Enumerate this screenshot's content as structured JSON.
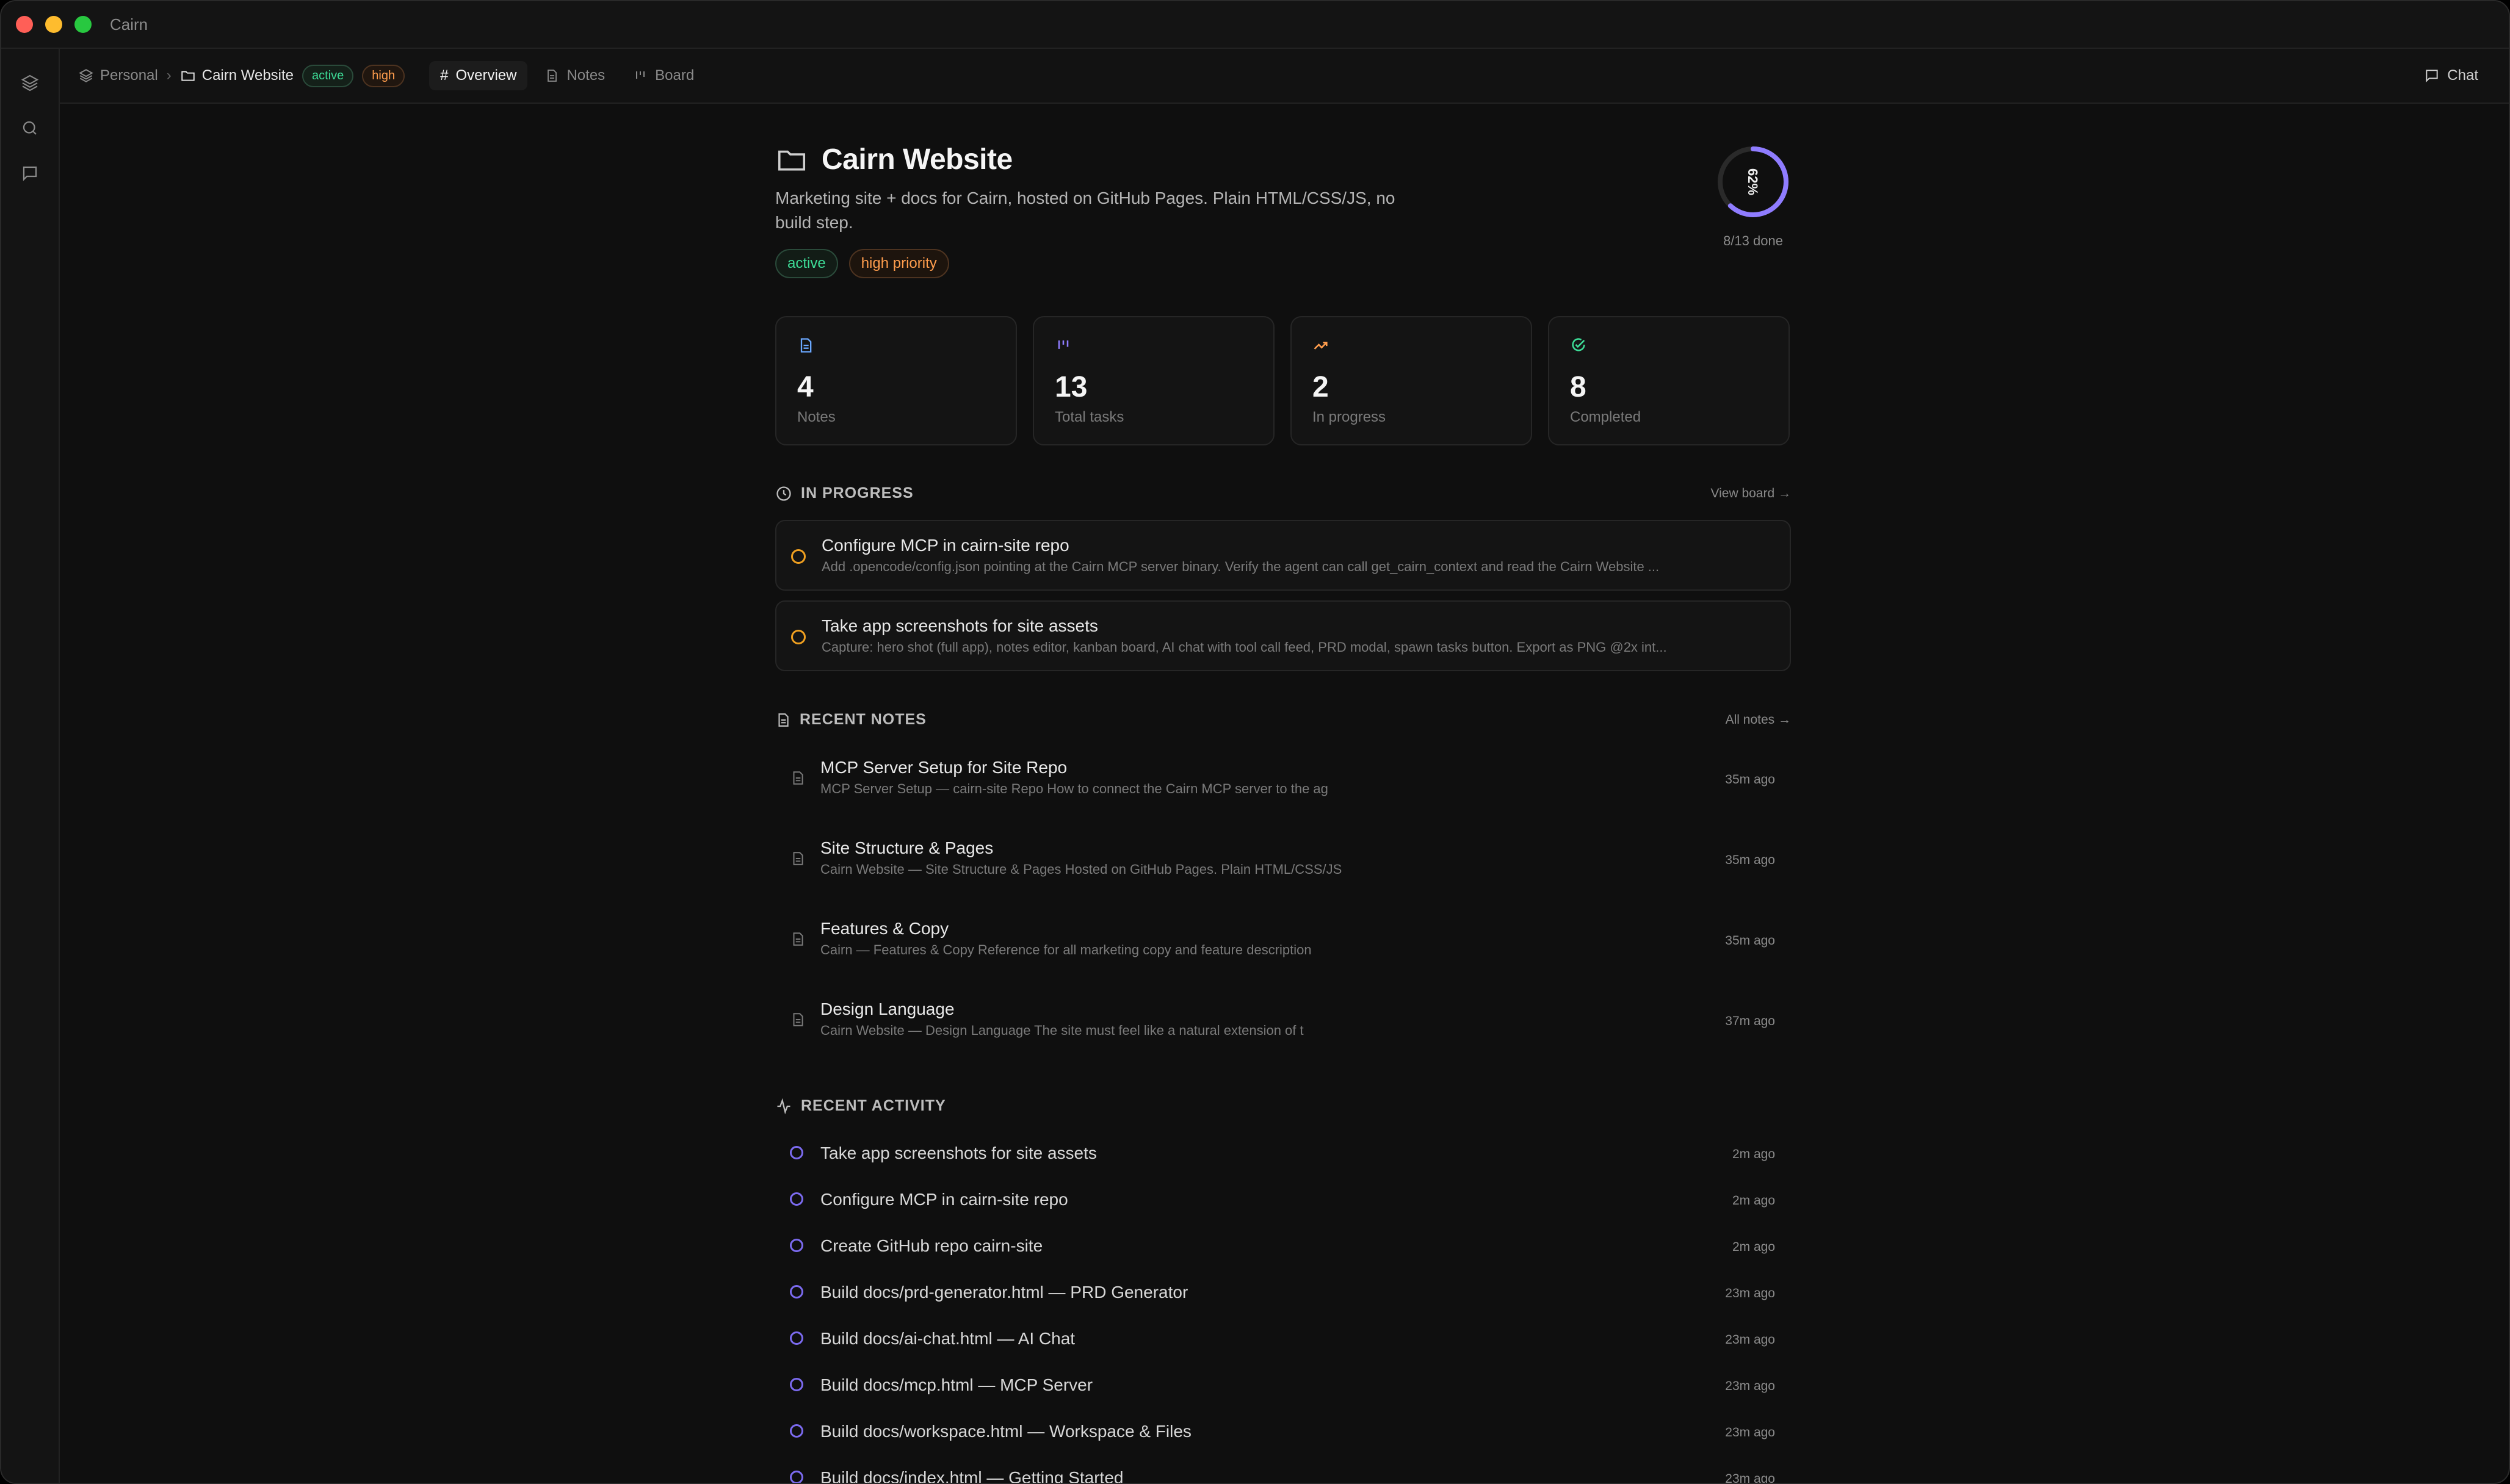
{
  "app": {
    "title": "Cairn"
  },
  "breadcrumb": {
    "workspace": "Personal",
    "project": "Cairn Website",
    "status_badge": "active",
    "priority_badge": "high"
  },
  "tabs": [
    {
      "label": "Overview"
    },
    {
      "label": "Notes"
    },
    {
      "label": "Board"
    }
  ],
  "chat": {
    "label": "Chat"
  },
  "project": {
    "title": "Cairn Website",
    "description": "Marketing site + docs for Cairn, hosted on GitHub Pages. Plain HTML/CSS/JS, no build step.",
    "tags": [
      {
        "label": "active",
        "color": "#3ddc97"
      },
      {
        "label": "high priority",
        "color": "#ff9d4d"
      }
    ],
    "progress": {
      "percent_label": "62%",
      "fraction": 0.62,
      "done_label": "8/13 done"
    }
  },
  "stats": [
    {
      "value": "4",
      "label": "Notes",
      "icon": "document-icon",
      "color": "#6aa8ff"
    },
    {
      "value": "13",
      "label": "Total tasks",
      "icon": "kanban-icon",
      "color": "#8f7cff"
    },
    {
      "value": "2",
      "label": "In progress",
      "icon": "trending-up-icon",
      "color": "#ff9d4d"
    },
    {
      "value": "8",
      "label": "Completed",
      "icon": "check-circle-icon",
      "color": "#3ddc97"
    }
  ],
  "in_progress": {
    "heading": "IN PROGRESS",
    "link": "View board →",
    "items": [
      {
        "title": "Configure MCP in cairn-site repo",
        "subtitle": "Add .opencode/config.json pointing at the Cairn MCP server binary. Verify the agent can call get_cairn_context and read the Cairn Website ..."
      },
      {
        "title": "Take app screenshots for site assets",
        "subtitle": "Capture: hero shot (full app), notes editor, kanban board, AI chat with tool call feed, PRD modal, spawn tasks button. Export as PNG @2x int..."
      }
    ]
  },
  "recent_notes": {
    "heading": "RECENT NOTES",
    "link": "All notes →",
    "items": [
      {
        "title": "MCP Server Setup for Site Repo",
        "subtitle": "MCP Server Setup — cairn-site Repo How to connect the Cairn MCP server to the ag",
        "time": "35m ago"
      },
      {
        "title": "Site Structure & Pages",
        "subtitle": "Cairn Website — Site Structure & Pages Hosted on GitHub Pages. Plain HTML/CSS/JS",
        "time": "35m ago"
      },
      {
        "title": "Features & Copy",
        "subtitle": "Cairn — Features & Copy Reference for all marketing copy and feature description",
        "time": "35m ago"
      },
      {
        "title": "Design Language",
        "subtitle": "Cairn Website — Design Language The site must feel like a natural extension of t",
        "time": "37m ago"
      }
    ]
  },
  "recent_activity": {
    "heading": "RECENT ACTIVITY",
    "items": [
      {
        "title": "Take app screenshots for site assets",
        "time": "2m ago"
      },
      {
        "title": "Configure MCP in cairn-site repo",
        "time": "2m ago"
      },
      {
        "title": "Create GitHub repo cairn-site",
        "time": "2m ago"
      },
      {
        "title": "Build docs/prd-generator.html — PRD Generator",
        "time": "23m ago"
      },
      {
        "title": "Build docs/ai-chat.html — AI Chat",
        "time": "23m ago"
      },
      {
        "title": "Build docs/mcp.html — MCP Server",
        "time": "23m ago"
      },
      {
        "title": "Build docs/workspace.html — Workspace & Files",
        "time": "23m ago"
      },
      {
        "title": "Build docs/index.html — Getting Started",
        "time": "23m ago"
      }
    ]
  },
  "colors": {
    "accent": "#8f7cff",
    "in_progress": "#f0a020",
    "background": "#0f0f0f"
  }
}
